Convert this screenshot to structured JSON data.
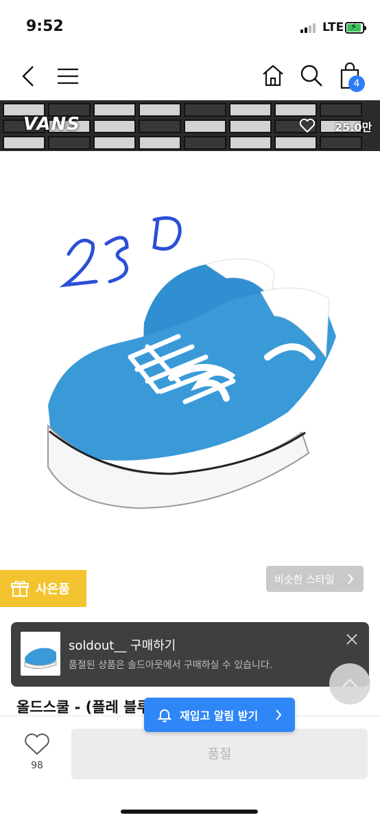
{
  "status": {
    "time": "9:52",
    "network": "LTE",
    "battery_color": "#39c25a"
  },
  "nav": {
    "back_icon": "chevron-left-icon",
    "menu_icon": "hamburger-icon",
    "home_icon": "home-icon",
    "search_icon": "search-icon",
    "cart_icon": "shopping-bag-icon",
    "cart_count": "4",
    "accent": "#2f7df6"
  },
  "banner": {
    "brand": "VANS",
    "likes": "25.0만"
  },
  "product_image": {
    "handwritten_size": "230"
  },
  "gift": {
    "label": "사은품",
    "color": "#f4c430"
  },
  "similar_style": {
    "label": "비슷한 스타일"
  },
  "toast": {
    "title": "soldout__ 구매하기",
    "subtitle": "품절된 상품은 솔드아웃에서 구매하실 수 있습니다."
  },
  "product": {
    "title": "올드스쿨 - (플레                                      블루:트루"
  },
  "restock": {
    "label": "재입고 알림 받기",
    "color": "#2f86f6"
  },
  "bottom_bar": {
    "like_count": "98",
    "soldout_label": "품절"
  }
}
